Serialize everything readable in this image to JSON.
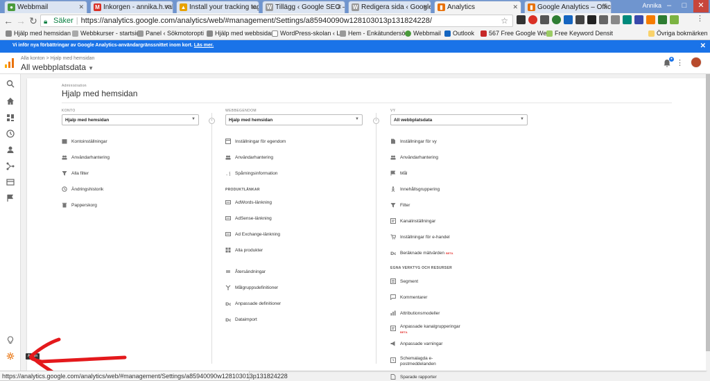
{
  "window": {
    "user": "Annika",
    "tabs": [
      {
        "title": "Webbmail",
        "color": "#4b9b3c"
      },
      {
        "title": "Inkorgen - annika.h.vallg",
        "color": "#d93025"
      },
      {
        "title": "Install your tracking tag",
        "color": "#e8a200"
      },
      {
        "title": "Tillägg ‹ Google SEO — ",
        "color": "#777777"
      },
      {
        "title": "Redigera sida ‹ Google S",
        "color": "#777777"
      },
      {
        "title": "Analytics",
        "color": "#e8710a"
      },
      {
        "title": "Google Analytics – Offic",
        "color": "#e8710a"
      }
    ]
  },
  "toolbar": {
    "secure_label": "Säker",
    "url": "https://analytics.google.com/analytics/web/#management/Settings/a85940090w128103013p131824228/"
  },
  "bookmarks": [
    "Hjälp med hemsidan",
    "Webbkurser - startsid",
    "Panel ‹ Sökmotoropti",
    "Hjälp med webbsidan",
    "WordPress-skolan ‹ L",
    "Hem - Enkätundersö",
    "Webbmail",
    "Outlook",
    "567 Free Google Web",
    "Free Keyword Densit",
    "Övriga bokmärken"
  ],
  "banner": {
    "text": "Vi inför nya förbättringar av Google Analytics-användargränssnittet inom kort.",
    "link": "Läs mer."
  },
  "header": {
    "breadcrumb": "Alla konton > Hjalp med hemsidan",
    "property": "All webbplatsdata"
  },
  "admin": {
    "small_label": "Administration",
    "title": "Hjalp med hemsidan",
    "tooltip": "Admin",
    "konto": {
      "heading": "KONTO",
      "selected": "Hjalp med hemsidan",
      "items": [
        "Kontoinställningar",
        "Användarhantering",
        "Alla filter",
        "Ändringshistorik",
        "Papperskorg"
      ]
    },
    "egendom": {
      "heading": "WEBBEGENDOM",
      "selected": "Hjalp med hemsidan",
      "items": [
        "Inställningar för egendom",
        "Användarhantering",
        "Spårningsinformation"
      ],
      "links_heading": "PRODUKTLÄNKAR",
      "links": [
        "AdWords-länkning",
        "AdSense-länkning",
        "Ad Exchange-länkning",
        "Alla produkter"
      ],
      "extra": [
        "Återsändningar",
        "Målgruppsdefinitioner",
        "Anpassade definitioner",
        "Dataimport"
      ]
    },
    "vy": {
      "heading": "VY",
      "selected": "All webbplatsdata",
      "items": [
        "Inställningar för vy",
        "Användarhantering",
        "Mål",
        "Innehållsgruppering",
        "Filter",
        "Kanalinställningar",
        "Inställningar för e-handel",
        "Beräknade mätvärden"
      ],
      "tools_heading": "EGNA VERKTYG OCH RESURSER",
      "tools": [
        "Segment",
        "Kommentarer",
        "Attributionsmodeller",
        "Anpassade kanalgrupperingar",
        "Anpassade varningar",
        "Schemalagda e-postmeddelanden",
        "Sparade rapporter"
      ],
      "beta": "BETA"
    }
  },
  "status_bar": "https://analytics.google.com/analytics/web/#management/Settings/a85940090w128103013p131824228",
  "colors": {
    "accent": "#e8710a",
    "banner": "#1a73e8",
    "annotation": "#e4191c"
  }
}
